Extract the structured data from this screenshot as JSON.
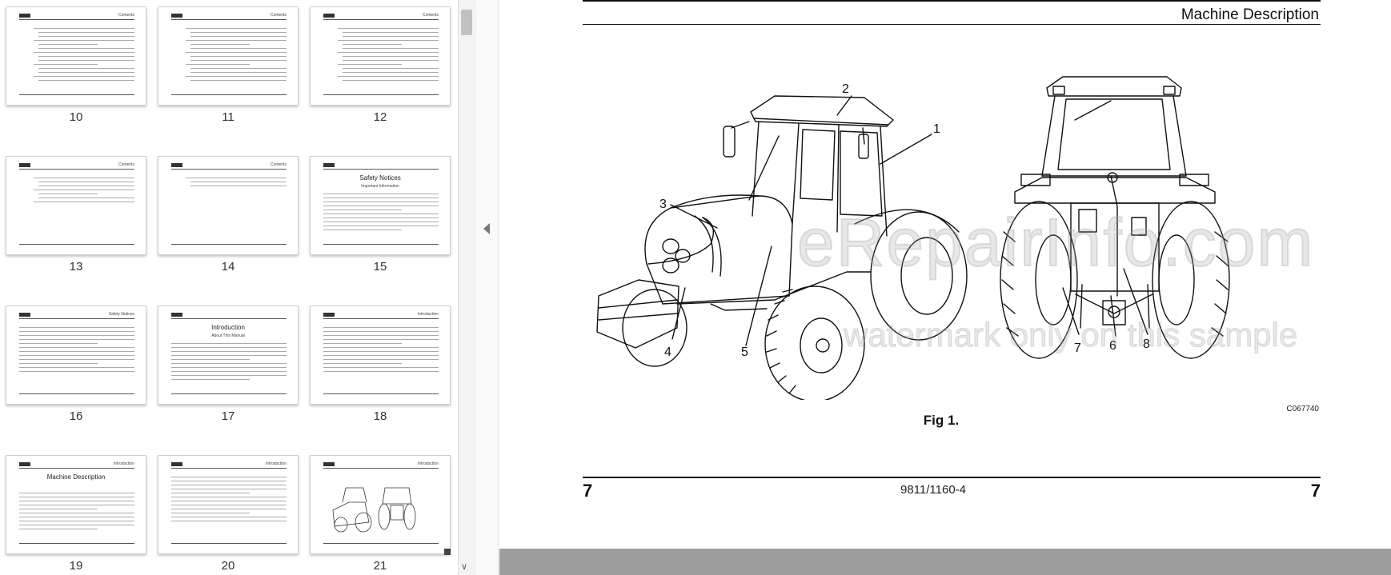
{
  "thumbnails": [
    {
      "page": "10",
      "kind": "contents",
      "header": "Contents"
    },
    {
      "page": "11",
      "kind": "contents",
      "header": "Contents"
    },
    {
      "page": "12",
      "kind": "contents",
      "header": "Contents"
    },
    {
      "page": "13",
      "kind": "contents-short",
      "header": "Contents"
    },
    {
      "page": "14",
      "kind": "contents-min",
      "header": "Contents"
    },
    {
      "page": "15",
      "kind": "heading",
      "header": "",
      "heading": "Safety Notices",
      "subheading": "Important Information"
    },
    {
      "page": "16",
      "kind": "text",
      "header": "Safety Notices"
    },
    {
      "page": "17",
      "kind": "heading",
      "header": "",
      "heading": "Introduction",
      "subheading": "About This Manual"
    },
    {
      "page": "18",
      "kind": "text",
      "header": "Introduction"
    },
    {
      "page": "19",
      "kind": "heading",
      "header": "Introduction",
      "heading": "Machine Description",
      "subheading": ""
    },
    {
      "page": "20",
      "kind": "text",
      "header": "Introduction"
    },
    {
      "page": "21",
      "kind": "figure",
      "header": "Introduction"
    }
  ],
  "page": {
    "section_title": "Machine Description",
    "callouts": [
      "1",
      "2",
      "3",
      "4",
      "5",
      "6",
      "7",
      "8"
    ],
    "figure_caption": "Fig 1.",
    "figure_code": "C067740",
    "page_number_left": "7",
    "page_number_right": "7",
    "doc_code": "9811/1160-4"
  },
  "watermark": {
    "line1": "eRepairInfo.com",
    "line2": "watermark only on this sample"
  },
  "icons": {
    "collapse": "chevron-left-icon",
    "scroll_down": "chevron-down-icon"
  }
}
